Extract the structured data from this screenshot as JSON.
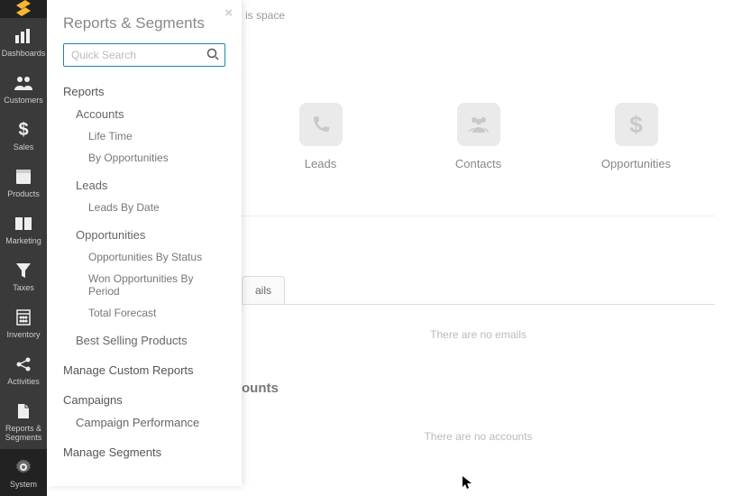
{
  "sidebar": {
    "items": [
      {
        "label": "Dashboards",
        "icon": "bar-chart-icon"
      },
      {
        "label": "Customers",
        "icon": "users-icon"
      },
      {
        "label": "Sales",
        "icon": "dollar-icon"
      },
      {
        "label": "Products",
        "icon": "box-icon"
      },
      {
        "label": "Marketing",
        "icon": "book-icon"
      },
      {
        "label": "Taxes",
        "icon": "funnel-icon"
      },
      {
        "label": "Inventory",
        "icon": "calculator-icon"
      },
      {
        "label": "Activities",
        "icon": "share-icon"
      },
      {
        "label": "Reports & Segments",
        "icon": "file-icon"
      },
      {
        "label": "System",
        "icon": "gear-icon"
      }
    ],
    "active_index": 9
  },
  "main": {
    "breadcrumb_hint": "is space",
    "cards": [
      {
        "label": "Leads",
        "icon": "phone-icon"
      },
      {
        "label": "Contacts",
        "icon": "group-icon"
      },
      {
        "label": "Opportunities",
        "icon": "dollar-icon"
      }
    ],
    "emails_tab_label": "ails",
    "emails_empty": "There are no emails",
    "accounts_heading_partial": "ounts",
    "accounts_empty": "There are no accounts"
  },
  "panel": {
    "title": "Reports & Segments",
    "close_label": "×",
    "search_placeholder": "Quick Search",
    "tree": [
      {
        "label": "Reports",
        "children": [
          {
            "label": "Accounts",
            "children": [
              {
                "label": "Life Time"
              },
              {
                "label": "By Opportunities"
              }
            ]
          },
          {
            "label": "Leads",
            "children": [
              {
                "label": "Leads By Date"
              }
            ]
          },
          {
            "label": "Opportunities",
            "children": [
              {
                "label": "Opportunities By Status"
              },
              {
                "label": "Won Opportunities By Period"
              },
              {
                "label": "Total Forecast"
              }
            ]
          },
          {
            "label": "Best Selling Products"
          }
        ]
      },
      {
        "label": "Manage Custom Reports"
      },
      {
        "label": "Campaigns",
        "children": [
          {
            "label": "Campaign Performance"
          }
        ]
      },
      {
        "label": "Manage Segments"
      }
    ]
  }
}
